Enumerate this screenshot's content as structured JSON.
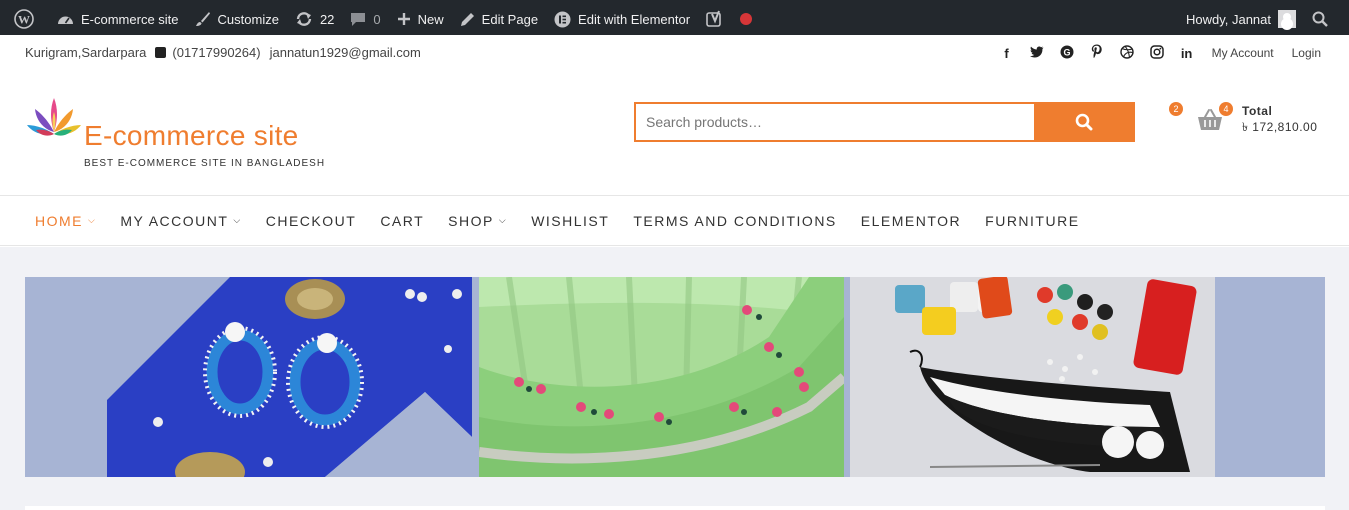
{
  "adminbar": {
    "site_name": "E-commerce site",
    "customize": "Customize",
    "updates_count": "22",
    "comments_count": "0",
    "new_label": "New",
    "edit_page": "Edit Page",
    "edit_elementor": "Edit with Elementor",
    "howdy": "Howdy, Jannat"
  },
  "topbar": {
    "location": "Kurigram,Sardarpara",
    "phone": "(01717990264)",
    "email": "jannatun1929@gmail.com",
    "my_account": "My Account",
    "login": "Login",
    "social_icons": [
      "facebook-icon",
      "twitter-icon",
      "google-plus-icon",
      "pinterest-icon",
      "dribbble-icon",
      "instagram-icon",
      "linkedin-icon"
    ]
  },
  "header": {
    "site_title": "E-commerce site",
    "tagline": "BEST E-COMMERCE SITE IN BANGLADESH",
    "search_placeholder": "Search products…",
    "wishlist_count": "2",
    "cart_count": "4",
    "total_label": "Total",
    "total_value": "৳ 172,810.00"
  },
  "nav": {
    "items": [
      {
        "label": "HOME",
        "dropdown": true
      },
      {
        "label": "MY ACCOUNT",
        "dropdown": true
      },
      {
        "label": "CHECKOUT",
        "dropdown": false
      },
      {
        "label": "CART",
        "dropdown": false
      },
      {
        "label": "SHOP",
        "dropdown": true
      },
      {
        "label": "WISHLIST",
        "dropdown": false
      },
      {
        "label": "TERMS AND CONDITIONS",
        "dropdown": false
      },
      {
        "label": "ELEMENTOR",
        "dropdown": false
      },
      {
        "label": "FURNITURE",
        "dropdown": false
      }
    ],
    "caret": "⌄"
  },
  "colors": {
    "accent": "#ef7d2f",
    "adminbar_bg": "#23282d",
    "content_bg": "#f1f2f6",
    "slider_bg": "#a7b4d4"
  }
}
